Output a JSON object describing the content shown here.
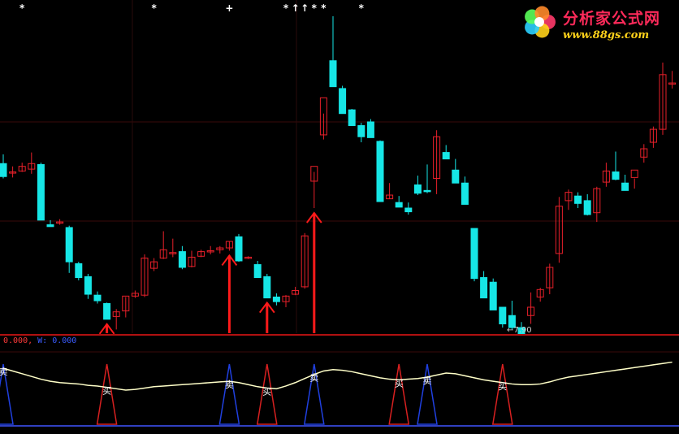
{
  "watermark": {
    "title": "分析家公式网",
    "url": "www.88gs.com",
    "logo_icon": "flower-logo-icon"
  },
  "indicator_legend": {
    "first": "0.000,",
    "second": "W: 0.000"
  },
  "price_annotation": "←7.90",
  "colors": {
    "background": "#000000",
    "up_candle": "#e8202a",
    "down_candle": "#16e6e6",
    "signal_arrow": "#ff1a1a",
    "separator": "#b01010",
    "indicator_line": "#ffffc8",
    "buy_triangle": "#d82020",
    "sell_triangle": "#2040e0"
  },
  "chart_data": [
    {
      "type": "candlestick",
      "ylim": [
        7.66,
        10.8
      ],
      "low_label": "7.90",
      "ohlc": [
        [
          9.21,
          9.31,
          9.05,
          9.07
        ],
        [
          9.12,
          9.18,
          9.06,
          9.12
        ],
        [
          9.13,
          9.22,
          9.12,
          9.18
        ],
        [
          9.15,
          9.33,
          9.1,
          9.21
        ],
        [
          9.2,
          9.22,
          8.6,
          8.6
        ],
        [
          8.55,
          8.6,
          8.53,
          8.53
        ],
        [
          8.58,
          8.61,
          8.55,
          8.58
        ],
        [
          8.52,
          8.54,
          8.03,
          8.15
        ],
        [
          8.13,
          8.15,
          7.95,
          7.98
        ],
        [
          7.99,
          8.02,
          7.75,
          7.8
        ],
        [
          7.79,
          7.83,
          7.7,
          7.73
        ],
        [
          7.7,
          7.71,
          7.53,
          7.53
        ],
        [
          7.56,
          7.64,
          7.42,
          7.61
        ],
        [
          7.62,
          7.77,
          7.55,
          7.78
        ],
        [
          7.78,
          7.84,
          7.76,
          7.81
        ],
        [
          7.79,
          8.23,
          7.77,
          8.19
        ],
        [
          8.08,
          8.19,
          8.05,
          8.15
        ],
        [
          8.19,
          8.48,
          8.18,
          8.28
        ],
        [
          8.24,
          8.4,
          8.2,
          8.25
        ],
        [
          8.26,
          8.32,
          8.07,
          8.09
        ],
        [
          8.1,
          8.27,
          8.09,
          8.2
        ],
        [
          8.21,
          8.28,
          8.2,
          8.26
        ],
        [
          8.26,
          8.32,
          8.23,
          8.27
        ],
        [
          8.28,
          8.32,
          8.24,
          8.3
        ],
        [
          8.3,
          8.37,
          8.27,
          8.37
        ],
        [
          8.42,
          8.45,
          8.15,
          8.16
        ],
        [
          8.19,
          8.21,
          8.18,
          8.2
        ],
        [
          8.12,
          8.16,
          7.98,
          7.98
        ],
        [
          7.99,
          8.02,
          7.76,
          7.76
        ],
        [
          7.77,
          7.81,
          7.68,
          7.72
        ],
        [
          7.72,
          7.79,
          7.66,
          7.78
        ],
        [
          7.8,
          7.88,
          7.79,
          7.84
        ],
        [
          7.88,
          8.46,
          7.86,
          8.43
        ],
        [
          9.02,
          9.12,
          8.73,
          9.18
        ],
        [
          9.52,
          9.75,
          9.47,
          9.92
        ],
        [
          10.32,
          10.8,
          10.05,
          10.04
        ],
        [
          10.02,
          10.05,
          9.78,
          9.75
        ],
        [
          9.79,
          9.8,
          9.63,
          9.62
        ],
        [
          9.62,
          9.65,
          9.44,
          9.5
        ],
        [
          9.66,
          9.69,
          9.57,
          9.49
        ],
        [
          9.45,
          9.46,
          8.8,
          8.8
        ],
        [
          8.83,
          9.0,
          8.83,
          8.87
        ],
        [
          8.79,
          8.86,
          8.75,
          8.74
        ],
        [
          8.73,
          8.79,
          8.66,
          8.69
        ],
        [
          8.98,
          9.08,
          8.87,
          8.89
        ],
        [
          8.92,
          9.2,
          8.89,
          8.91
        ],
        [
          9.05,
          9.57,
          8.88,
          9.5
        ],
        [
          9.33,
          9.41,
          9.27,
          9.26
        ],
        [
          9.14,
          9.26,
          9.09,
          9.0
        ],
        [
          9.0,
          9.07,
          8.77,
          8.77
        ],
        [
          8.51,
          8.5,
          7.94,
          7.97
        ],
        [
          7.98,
          8.05,
          7.78,
          7.76
        ],
        [
          7.93,
          7.97,
          7.65,
          7.63
        ],
        [
          7.66,
          7.64,
          7.44,
          7.48
        ],
        [
          7.57,
          7.73,
          7.42,
          7.44
        ],
        [
          7.44,
          7.5,
          7.37,
          7.36
        ],
        [
          7.57,
          7.82,
          7.48,
          7.66
        ],
        [
          7.77,
          7.87,
          7.72,
          7.85
        ],
        [
          7.87,
          8.13,
          7.8,
          8.09
        ],
        [
          8.24,
          8.85,
          8.14,
          8.75
        ],
        [
          8.81,
          8.93,
          8.71,
          8.9
        ],
        [
          8.86,
          8.9,
          8.73,
          8.78
        ],
        [
          8.81,
          8.88,
          8.65,
          8.66
        ],
        [
          8.68,
          8.96,
          8.58,
          8.94
        ],
        [
          9.01,
          9.22,
          8.96,
          9.13
        ],
        [
          9.12,
          9.34,
          9.03,
          9.04
        ],
        [
          9.0,
          9.09,
          8.92,
          8.92
        ],
        [
          9.06,
          9.05,
          8.94,
          9.14
        ],
        [
          9.28,
          9.42,
          9.22,
          9.37
        ],
        [
          9.44,
          9.61,
          9.38,
          9.58
        ],
        [
          9.58,
          10.3,
          9.52,
          10.17
        ],
        [
          10.08,
          10.21,
          10.02,
          10.08
        ]
      ]
    },
    {
      "type": "line",
      "ylim": [
        0,
        10
      ],
      "series": [
        {
          "values": [
            8.2,
            7.8,
            7.4,
            7.0,
            6.6,
            6.3,
            6.1,
            6.0,
            5.9,
            5.7,
            5.6,
            5.4,
            5.2,
            5.0,
            5.1,
            5.3,
            5.5,
            5.6,
            5.7,
            5.8,
            5.9,
            6.0,
            6.1,
            6.2,
            6.3,
            6.1,
            5.8,
            5.5,
            5.3,
            5.2,
            5.6,
            6.1,
            6.7,
            7.3,
            7.8,
            8.0,
            7.9,
            7.7,
            7.4,
            7.1,
            6.8,
            6.6,
            6.5,
            6.6,
            6.7,
            6.9,
            7.2,
            7.5,
            7.4,
            7.1,
            6.8,
            6.5,
            6.3,
            6.1,
            5.9,
            5.8,
            5.8,
            5.9,
            6.2,
            6.6,
            6.9,
            7.1,
            7.3,
            7.5,
            7.7,
            7.9,
            8.1,
            8.3,
            8.5,
            8.7,
            8.9,
            9.1
          ]
        }
      ],
      "signals": [
        {
          "label": "卖",
          "kind": "sell",
          "index": 0
        },
        {
          "label": "买",
          "kind": "buy",
          "index": 11
        },
        {
          "label": "卖",
          "kind": "sell",
          "index": 24
        },
        {
          "label": "买",
          "kind": "buy",
          "index": 28
        },
        {
          "label": "卖",
          "kind": "sell",
          "index": 33
        },
        {
          "label": "买",
          "kind": "buy",
          "index": 42
        },
        {
          "label": "卖",
          "kind": "sell",
          "index": 45
        },
        {
          "label": "买",
          "kind": "buy",
          "index": 53
        }
      ],
      "top_markers": [
        {
          "index": 2,
          "glyph": "*"
        },
        {
          "index": 16,
          "glyph": "*"
        },
        {
          "index": 24,
          "glyph": "+"
        },
        {
          "index": 30,
          "glyph": "*"
        },
        {
          "index": 31,
          "glyph": "↑"
        },
        {
          "index": 32,
          "glyph": "↑"
        },
        {
          "index": 33,
          "glyph": "*"
        },
        {
          "index": 34,
          "glyph": "*"
        },
        {
          "index": 38,
          "glyph": "*"
        }
      ],
      "red_arrows": [
        11,
        24,
        28,
        33
      ]
    }
  ]
}
